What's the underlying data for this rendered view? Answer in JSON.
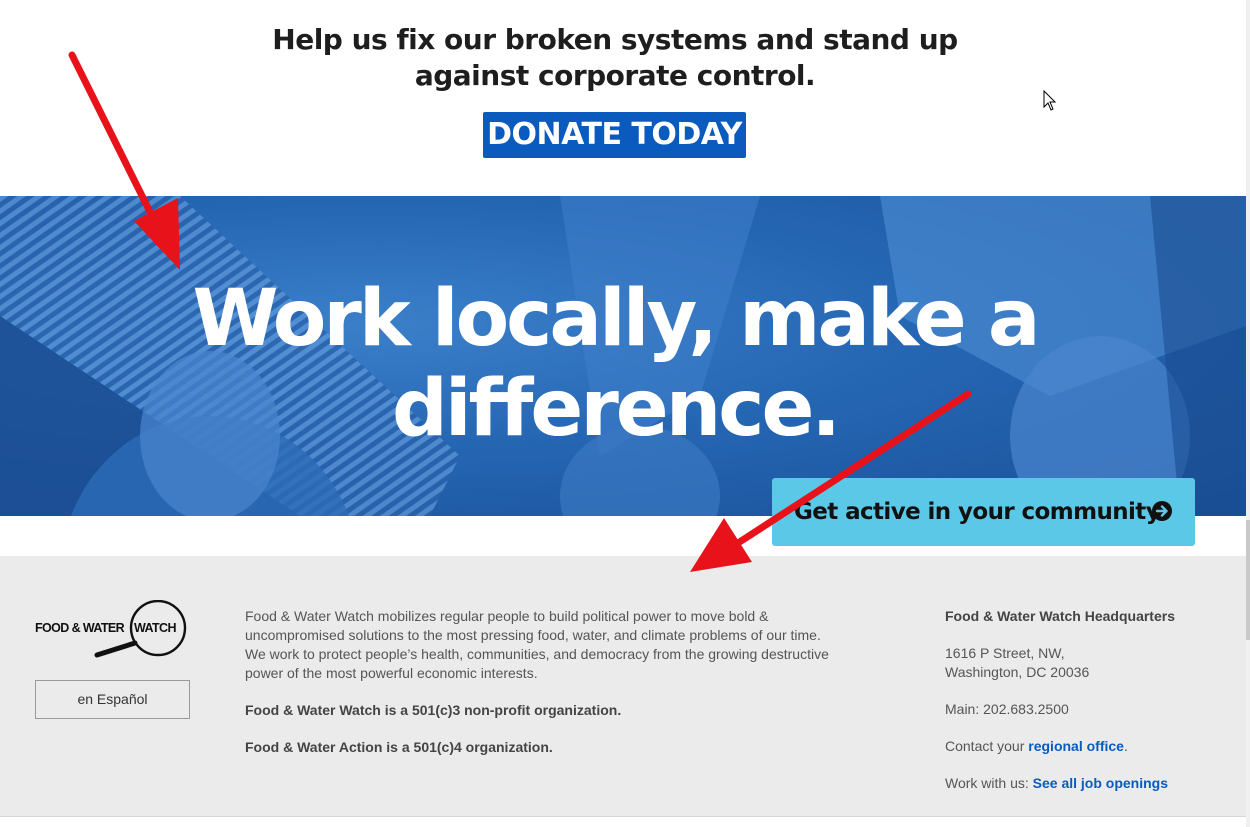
{
  "appeal": {
    "line1": "Help us fix our broken systems and stand up",
    "line2": "against corporate control.",
    "donate_label": "DONATE TODAY"
  },
  "hero": {
    "line1": "Work locally, make a",
    "line2": "difference.",
    "cta_label": "Get active in your community."
  },
  "footer": {
    "logo_text_left": "FOOD & WATER",
    "logo_text_right": "WATCH",
    "lang_button": "en Español",
    "about": "Food & Water Watch mobilizes regular people to build political power to move bold & uncompromised solutions to the most pressing food, water, and climate problems of our time. We work to protect people’s health, communities, and democracy from the growing destructive power of the most powerful economic interests.",
    "nonprofit_1": "Food & Water Watch is a 501(c)3 non-profit organization.",
    "nonprofit_2": "Food & Water Action is a 501(c)4 organization.",
    "hq_title": "Food & Water Watch Headquarters",
    "address_1": "1616 P Street, NW,",
    "address_2": "Washington, DC 20036",
    "phone": "Main: 202.683.2500",
    "contact_prefix": "Contact your ",
    "contact_link": "regional office",
    "contact_suffix": ".",
    "jobs_prefix": "Work with us: ",
    "jobs_link": "See all job openings"
  },
  "colors": {
    "brand_blue": "#0a5bbd",
    "cta_cyan": "#5cc8e8",
    "footer_bg": "#ebebeb",
    "annotation_red": "#e8131a"
  },
  "icons": [
    "arrow-right-circle-icon",
    "magnifier-logo-icon",
    "mouse-cursor-icon"
  ]
}
